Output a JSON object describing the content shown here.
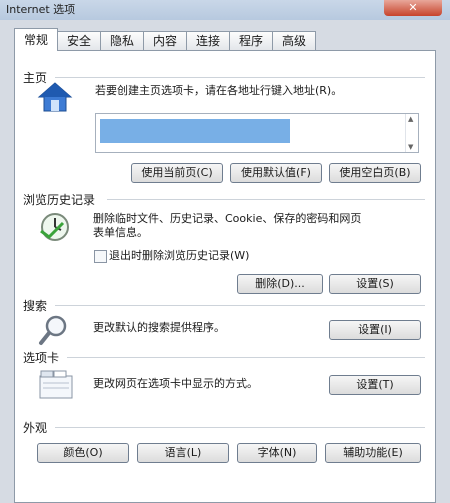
{
  "window": {
    "title": "Internet 选项"
  },
  "tabs": [
    "常规",
    "安全",
    "隐私",
    "内容",
    "连接",
    "程序",
    "高级"
  ],
  "home": {
    "title": "主页",
    "desc": "若要创建主页选项卡，请在各地址行键入地址(R)。",
    "buttons": {
      "current": "使用当前页(C)",
      "default": "使用默认值(F)",
      "blank": "使用空白页(B)"
    }
  },
  "history": {
    "title": "浏览历史记录",
    "desc_line1": "删除临时文件、历史记录、Cookie、保存的密码和网页",
    "desc_line2": "表单信息。",
    "checkbox": "退出时删除浏览历史记录(W)",
    "buttons": {
      "delete": "删除(D)...",
      "settings": "设置(S)"
    }
  },
  "search": {
    "title": "搜索",
    "desc": "更改默认的搜索提供程序。",
    "settings": "设置(I)"
  },
  "tabs_section": {
    "title": "选项卡",
    "desc": "更改网页在选项卡中显示的方式。",
    "settings": "设置(T)"
  },
  "appearance": {
    "title": "外观",
    "buttons": {
      "colors": "颜色(O)",
      "languages": "语言(L)",
      "fonts": "字体(N)",
      "accessibility": "辅助功能(E)"
    }
  }
}
